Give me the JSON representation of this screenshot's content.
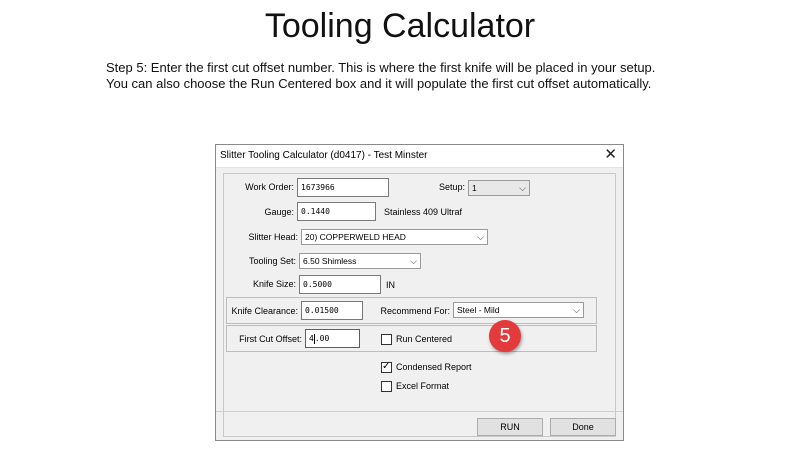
{
  "slide": {
    "title": "Tooling Calculator",
    "instructions_line1": "Step 5: Enter the first cut offset number. This is where the first knife will be placed in your setup.",
    "instructions_line2": "You can also choose the Run Centered box and it will populate the first cut offset automatically.",
    "step_badge": "5",
    "badge_color": "#e33b3b"
  },
  "dialog": {
    "title": "Slitter Tooling Calculator (d0417) - Test Minster",
    "close_glyph": "✕",
    "work_order": {
      "label": "Work Order:",
      "value": "1673966"
    },
    "setup": {
      "label": "Setup:",
      "value": "1"
    },
    "gauge": {
      "label": "Gauge:",
      "value": "0.1440",
      "material": "Stainless 409 Ultraf"
    },
    "slitter_head": {
      "label": "Slitter Head:",
      "value": "20) COPPERWELD HEAD"
    },
    "tooling_set": {
      "label": "Tooling Set:",
      "value": "6.50 Shimless"
    },
    "knife_size": {
      "label": "Knife Size:",
      "value": "0.5000",
      "unit": "IN"
    },
    "knife_clearance": {
      "label": "Knife Clearance:",
      "value": "0.01500"
    },
    "recommend_for": {
      "label": "Recommend For:",
      "value": "Steel - Mild"
    },
    "first_cut_offset": {
      "label": "First Cut Offset:",
      "value_before_caret": "4",
      "value_after_caret": ".00"
    },
    "run_centered": {
      "label": "Run Centered",
      "checked": false
    },
    "condensed_report": {
      "label": "Condensed Report",
      "checked": true,
      "mark": "✓"
    },
    "excel_format": {
      "label": "Excel Format",
      "checked": false
    },
    "run_button": "RUN",
    "done_button": "Done",
    "dropdown_arrow": "⌵",
    "accent_color": "#0078d7"
  }
}
